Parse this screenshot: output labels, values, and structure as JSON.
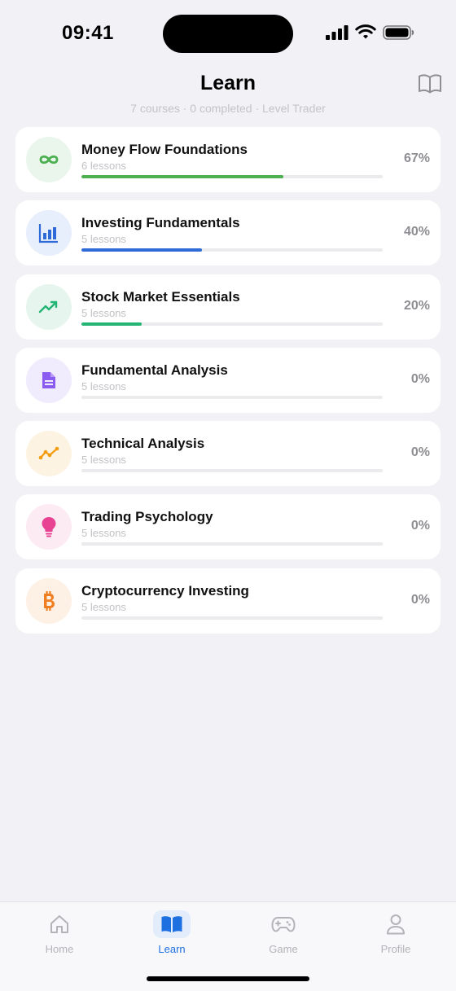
{
  "status_bar": {
    "time": "09:41"
  },
  "header": {
    "title": "Learn",
    "subtitle": "7 courses · 0 completed · Level Trader",
    "action_icon": "book-open-icon"
  },
  "courses": [
    {
      "title": "Money Flow Foundations",
      "lessons": "6 lessons",
      "percent": "67%",
      "progress": 0.67,
      "icon": "infinity-icon",
      "color": "#4caf50",
      "icon_bg": "#eaf6eb"
    },
    {
      "title": "Investing Fundamentals",
      "lessons": "5 lessons",
      "percent": "40%",
      "progress": 0.4,
      "icon": "bar-chart-icon",
      "color": "#2f6bd8",
      "icon_bg": "#e7eefc"
    },
    {
      "title": "Stock Market Essentials",
      "lessons": "5 lessons",
      "percent": "20%",
      "progress": 0.2,
      "icon": "trending-up-icon",
      "color": "#22b573",
      "icon_bg": "#e6f6ee"
    },
    {
      "title": "Fundamental Analysis",
      "lessons": "5 lessons",
      "percent": "0%",
      "progress": 0.0,
      "icon": "document-icon",
      "color": "#8a5cf0",
      "icon_bg": "#f1ecfd"
    },
    {
      "title": "Technical Analysis",
      "lessons": "5 lessons",
      "percent": "0%",
      "progress": 0.0,
      "icon": "line-chart-icon",
      "color": "#f39c12",
      "icon_bg": "#fdf3e3"
    },
    {
      "title": "Trading Psychology",
      "lessons": "5 lessons",
      "percent": "0%",
      "progress": 0.0,
      "icon": "lightbulb-icon",
      "color": "#e84393",
      "icon_bg": "#fcebf3"
    },
    {
      "title": "Cryptocurrency Investing",
      "lessons": "5 lessons",
      "percent": "0%",
      "progress": 0.0,
      "icon": "bitcoin-icon",
      "color": "#f07f22",
      "icon_bg": "#fdf0e4"
    }
  ],
  "tabs": [
    {
      "label": "Home",
      "icon": "home-icon",
      "active": false
    },
    {
      "label": "Learn",
      "icon": "book-icon",
      "active": true
    },
    {
      "label": "Game",
      "icon": "gamepad-icon",
      "active": false
    },
    {
      "label": "Profile",
      "icon": "person-icon",
      "active": false
    }
  ],
  "colors": {
    "accent": "#1e6fe0",
    "background": "#f1f1f6"
  }
}
